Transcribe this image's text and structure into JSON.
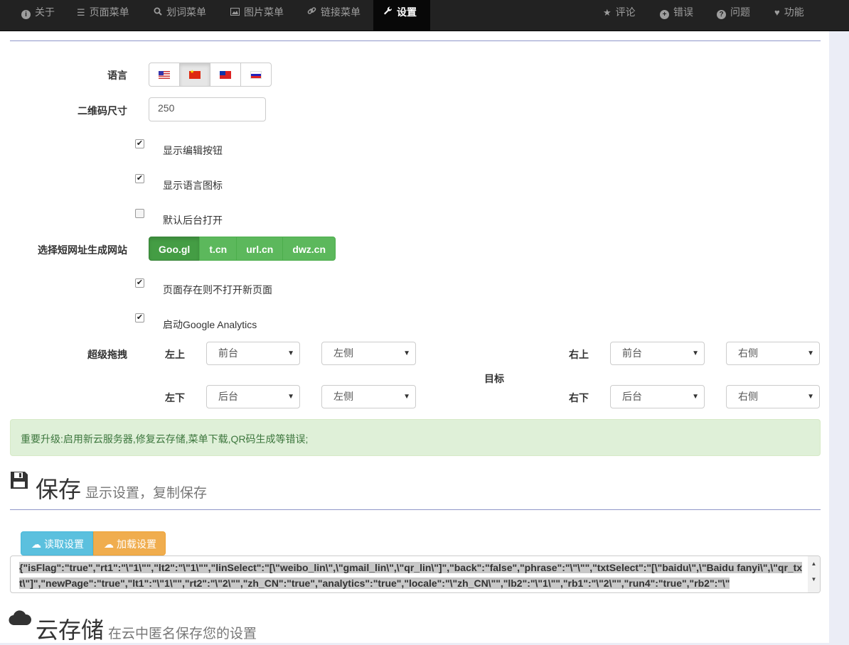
{
  "nav": {
    "left": [
      {
        "label": "关于",
        "icon": "info-circle-icon"
      },
      {
        "label": "页面菜单",
        "icon": "list-icon"
      },
      {
        "label": "划词菜单",
        "icon": "search-icon"
      },
      {
        "label": "图片菜单",
        "icon": "picture-icon"
      },
      {
        "label": "链接菜单",
        "icon": "link-icon"
      },
      {
        "label": "设置",
        "icon": "wrench-icon",
        "active": true
      }
    ],
    "right": [
      {
        "label": "评论",
        "icon": "star-icon"
      },
      {
        "label": "错误",
        "icon": "plus-circle-icon"
      },
      {
        "label": "问题",
        "icon": "question-circle-icon"
      },
      {
        "label": "功能",
        "icon": "heart-icon"
      }
    ]
  },
  "settings": {
    "language_label": "语言",
    "qr_size_label": "二维码尺寸",
    "qr_size_value": "250",
    "show_edit_button": "显示编辑按钮",
    "show_language_icon": "显示语言图标",
    "default_background_open": "默认后台打开",
    "short_url_label": "选择短网址生成网站",
    "short_url_options": [
      "Goo.gl",
      "t.cn",
      "url.cn",
      "dwz.cn"
    ],
    "page_exists_no_new": "页面存在则不打开新页面",
    "enable_ga": "启动Google Analytics",
    "super_drag_label": "超级拖拽",
    "target_label": "目标",
    "top_left": "左上",
    "top_right": "右上",
    "bottom_left": "左下",
    "bottom_right": "右下",
    "tl_open": "前台",
    "tl_side": "左侧",
    "tr_open": "前台",
    "tr_side": "右侧",
    "bl_open": "后台",
    "bl_side": "左侧",
    "br_open": "后台",
    "br_side": "右侧"
  },
  "alert": {
    "text": "重要升级:启用新云服务器,修复云存储,菜单下载,QR码生成等错误;"
  },
  "save": {
    "title": "保存",
    "subtitle": "显示设置，复制保存",
    "read_button": "读取设置",
    "load_button": "加载设置",
    "json_text": "{\"isFlag\":\"true\",\"rt1\":\"\\\"1\\\"\",\"lt2\":\"\\\"1\\\"\",\"linSelect\":\"[\\\"weibo_lin\\\",\\\"gmail_lin\\\",\\\"qr_lin\\\"]\",\"back\":\"false\",\"phrase\":\"\\\"\\\"\",\"txtSelect\":\"[\\\"baidu\\\",\\\"Baidu fanyi\\\",\\\"qr_txt\\\"]\",\"newPage\":\"true\",\"lt1\":\"\\\"1\\\"\",\"rt2\":\"\\\"2\\\"\",\"zh_CN\":\"true\",\"analytics\":\"true\",\"locale\":\"\\\"zh_CN\\\"\",\"lb2\":\"\\\"1\\\"\",\"rb1\":\"\\\"2\\\"\",\"run4\":\"true\",\"rb2\":\"\\\""
  },
  "cloud": {
    "title": "云存储",
    "subtitle": "在云中匿名保存您的设置"
  }
}
